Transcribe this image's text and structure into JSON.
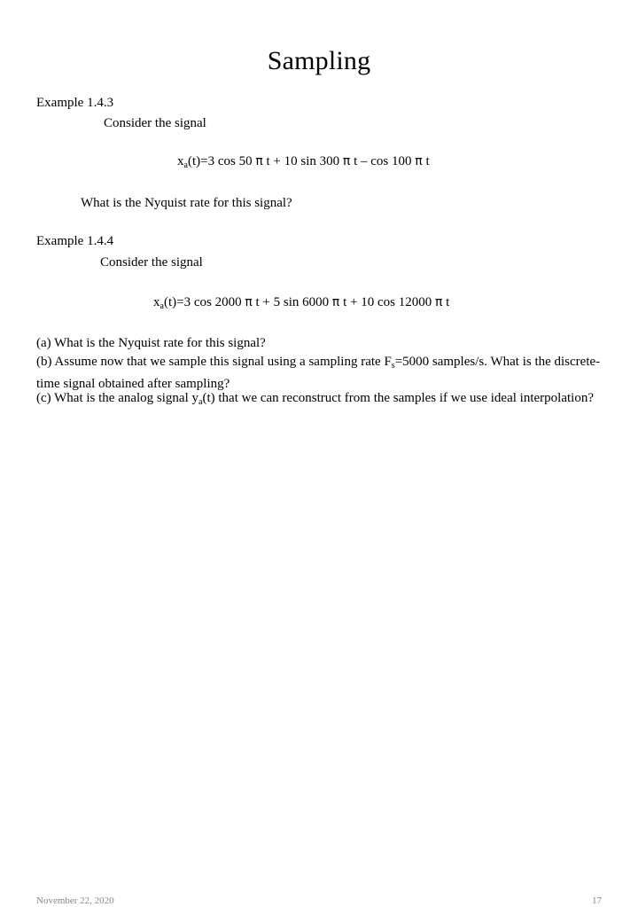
{
  "slide": {
    "title": "Sampling",
    "example1": {
      "heading": "Example 1.4.3",
      "consider": "Consider the signal",
      "equation": {
        "lhs": "x",
        "lhs_sub": "a",
        "rest_1": "(t)=3 cos 50 ",
        "pi_1": "π",
        "rest_2": " t + 10 sin 300 ",
        "pi_2": "π",
        "rest_3": " t – cos 100 ",
        "pi_3": "π",
        "rest_4": " t",
        "plain": "xa(t)=3 cos 50 π t + 10 sin 300 π t – cos 100 π t"
      },
      "question": "What is the Nyquist rate for this signal?"
    },
    "example2": {
      "heading": "Example 1.4.4",
      "consider": "Consider the signal",
      "equation": {
        "lhs": "x",
        "lhs_sub": "a",
        "rest_1": "(t)=3 cos 2000 ",
        "pi_1": "π",
        "rest_2": " t + 5 sin 6000 ",
        "pi_2": "π",
        "rest_3": " t +  10 cos 12000 ",
        "pi_3": "π",
        "rest_4": " t",
        "plain": "xa(t)=3 cos 2000 π t + 5 sin 6000 π t +  10 cos 12000 π t"
      },
      "questions": {
        "a": "(a) What is the Nyquist rate for this signal?",
        "b_part1": "(b) Assume now that we sample this signal using a sampling rate F",
        "b_sub": "s",
        "b_part2": "=5000 samples/s. What is the discrete-time signal obtained after sampling?",
        "c_part1": "(c) What is the analog signal y",
        "c_sub": "a",
        "c_part2": "(t) that we can reconstruct from the samples if we use ideal interpolation?"
      }
    },
    "footer": {
      "date": "November 22, 2020",
      "page_number": "17"
    }
  }
}
